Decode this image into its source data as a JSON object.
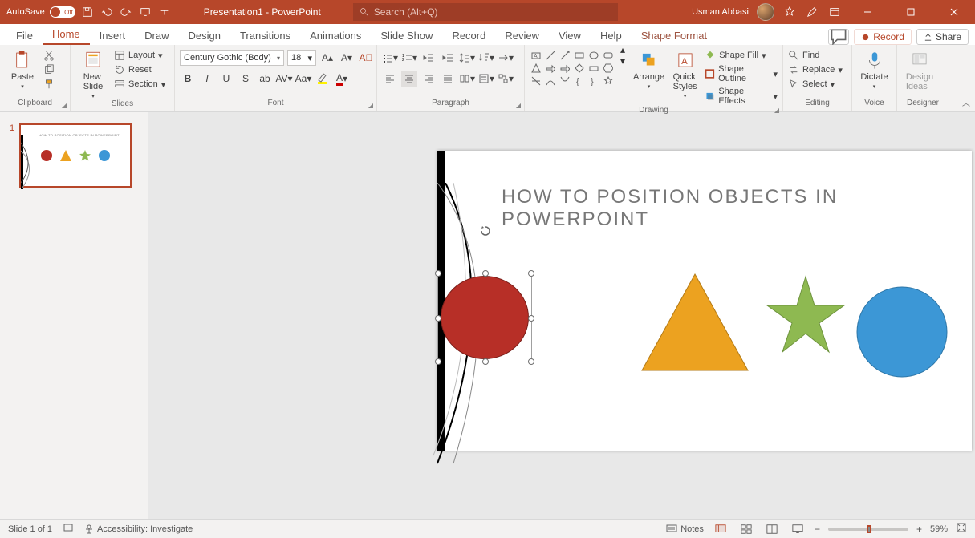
{
  "titlebar": {
    "autosave_label": "AutoSave",
    "autosave_state": "Off",
    "document_title": "Presentation1 - PowerPoint",
    "search_placeholder": "Search (Alt+Q)",
    "user_name": "Usman Abbasi"
  },
  "tabs": {
    "items": [
      "File",
      "Home",
      "Insert",
      "Draw",
      "Design",
      "Transitions",
      "Animations",
      "Slide Show",
      "Record",
      "Review",
      "View",
      "Help",
      "Shape Format"
    ],
    "active_index": 1,
    "comments_tooltip": "Comments",
    "record_label": "Record",
    "share_label": "Share"
  },
  "ribbon": {
    "clipboard": {
      "label": "Clipboard",
      "paste": "Paste"
    },
    "slides": {
      "label": "Slides",
      "new_slide": "New\nSlide",
      "layout": "Layout",
      "reset": "Reset",
      "section": "Section"
    },
    "font": {
      "label": "Font",
      "name": "Century Gothic (Body)",
      "size": "18"
    },
    "paragraph": {
      "label": "Paragraph"
    },
    "drawing": {
      "label": "Drawing",
      "arrange": "Arrange",
      "quick_styles": "Quick\nStyles",
      "shape_fill": "Shape Fill",
      "shape_outline": "Shape Outline",
      "shape_effects": "Shape Effects"
    },
    "editing": {
      "label": "Editing",
      "find": "Find",
      "replace": "Replace",
      "select": "Select"
    },
    "voice": {
      "label": "Voice",
      "dictate": "Dictate"
    },
    "designer": {
      "label": "Designer",
      "design_ideas": "Design\nIdeas"
    }
  },
  "slide_thumb": {
    "number": "1",
    "title": "HOW TO POSITION OBJECTS  IN POWERPOINT"
  },
  "slide": {
    "title": "HOW TO POSITION OBJECTS  IN POWERPOINT",
    "shapes": {
      "selected": "red-circle",
      "items": [
        "red-circle",
        "orange-triangle",
        "green-star",
        "blue-circle"
      ]
    }
  },
  "statusbar": {
    "slide_counter": "Slide 1 of 1",
    "accessibility": "Accessibility: Investigate",
    "notes_label": "Notes",
    "zoom_value": "59%"
  },
  "colors": {
    "brand": "#b7472a",
    "red_shape": "#b72f27",
    "orange_shape": "#eca220",
    "green_shape": "#8eb951",
    "blue_shape": "#3c97d6"
  }
}
